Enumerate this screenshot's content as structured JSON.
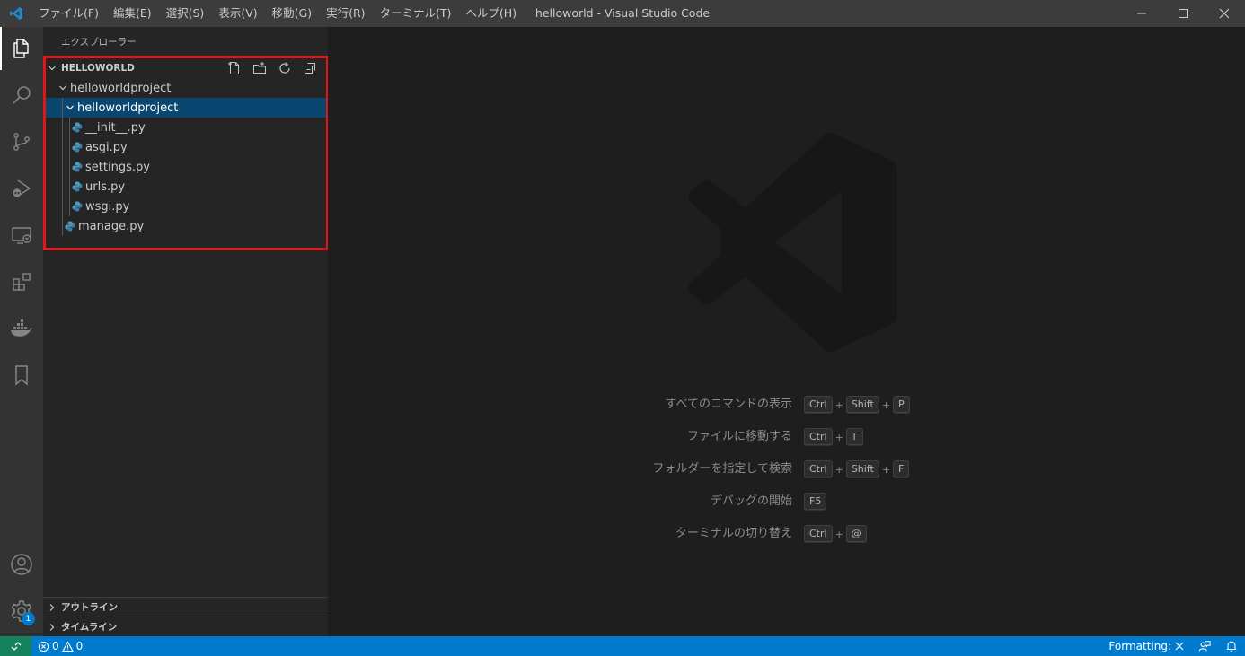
{
  "titlebar": {
    "menu": [
      "ファイル(F)",
      "編集(E)",
      "選択(S)",
      "表示(V)",
      "移動(G)",
      "実行(R)",
      "ターミナル(T)",
      "ヘルプ(H)"
    ],
    "title": "helloworld - Visual Studio Code"
  },
  "activitybar": {
    "items": [
      "files-icon",
      "search-icon",
      "source-control-icon",
      "run-debug-icon",
      "remote-explorer-icon",
      "extensions-icon",
      "docker-icon",
      "bookmark-icon"
    ],
    "bottom": [
      "account-icon",
      "settings-gear-icon"
    ],
    "settings_badge": "1"
  },
  "sidebar": {
    "title": "エクスプローラー",
    "section": "HELLOWORLD",
    "tree": [
      {
        "label": "helloworldproject",
        "type": "folder"
      },
      {
        "label": "helloworldproject",
        "type": "folder",
        "selected": true
      },
      {
        "label": "__init__.py",
        "type": "python"
      },
      {
        "label": "asgi.py",
        "type": "python"
      },
      {
        "label": "settings.py",
        "type": "python"
      },
      {
        "label": "urls.py",
        "type": "python"
      },
      {
        "label": "wsgi.py",
        "type": "python"
      },
      {
        "label": "manage.py",
        "type": "python"
      }
    ],
    "outline": "アウトライン",
    "timeline": "タイムライン"
  },
  "editor": {
    "shortcuts": [
      {
        "label": "すべてのコマンドの表示",
        "keys": [
          "Ctrl",
          "Shift",
          "P"
        ]
      },
      {
        "label": "ファイルに移動する",
        "keys": [
          "Ctrl",
          "T"
        ]
      },
      {
        "label": "フォルダーを指定して検索",
        "keys": [
          "Ctrl",
          "Shift",
          "F"
        ]
      },
      {
        "label": "デバッグの開始",
        "keys": [
          "F5"
        ]
      },
      {
        "label": "ターミナルの切り替え",
        "keys": [
          "Ctrl",
          "@"
        ]
      }
    ]
  },
  "statusbar": {
    "errors": "0",
    "warnings": "0",
    "formatting": "Formatting:"
  },
  "colors": {
    "accent": "#007acc",
    "selection": "#094771",
    "highlight": "#e3151c",
    "remote": "#16825d"
  }
}
